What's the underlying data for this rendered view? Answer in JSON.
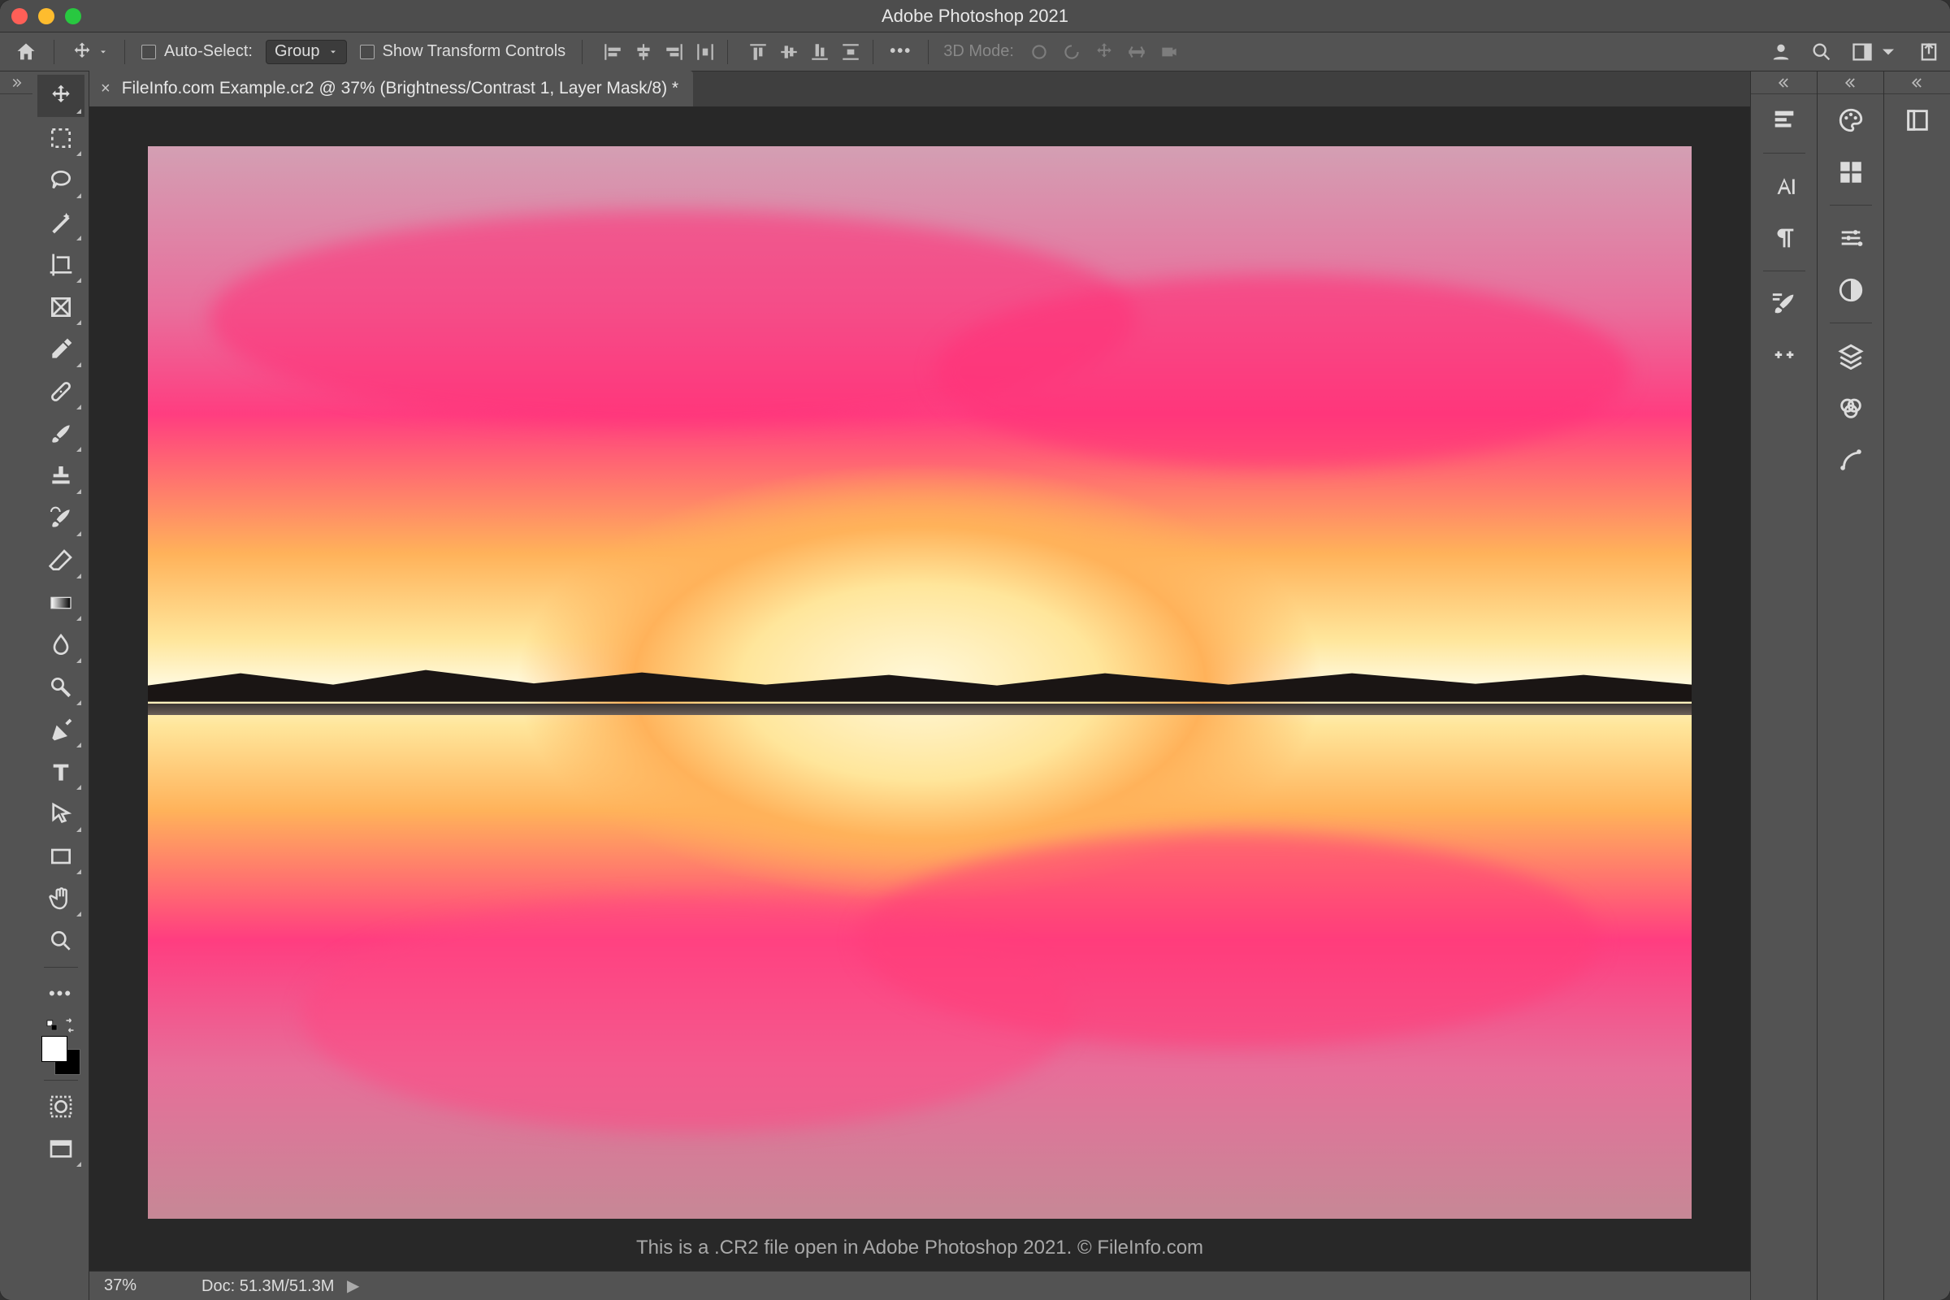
{
  "titlebar": {
    "title": "Adobe Photoshop 2021"
  },
  "optbar": {
    "auto_select_label": "Auto-Select:",
    "group_label": "Group",
    "show_transform_label": "Show Transform Controls",
    "mode3d_label": "3D Mode:"
  },
  "document": {
    "tab_label": "FileInfo.com Example.cr2 @ 37% (Brightness/Contrast 1, Layer Mask/8) *",
    "caption": "This is a .CR2 file open in Adobe Photoshop 2021. © FileInfo.com"
  },
  "status": {
    "zoom": "37%",
    "doc_info": "Doc: 51.3M/51.3M"
  },
  "tools": [
    {
      "name": "move-tool",
      "selected": true
    },
    {
      "name": "marquee-tool"
    },
    {
      "name": "lasso-tool"
    },
    {
      "name": "magic-wand-tool"
    },
    {
      "name": "crop-tool"
    },
    {
      "name": "frame-tool"
    },
    {
      "name": "eyedropper-tool"
    },
    {
      "name": "healing-brush-tool"
    },
    {
      "name": "brush-tool"
    },
    {
      "name": "clone-stamp-tool"
    },
    {
      "name": "history-brush-tool"
    },
    {
      "name": "eraser-tool"
    },
    {
      "name": "gradient-tool"
    },
    {
      "name": "pen-drop-tool"
    },
    {
      "name": "dodge-tool"
    },
    {
      "name": "pen-tool"
    },
    {
      "name": "type-tool"
    },
    {
      "name": "path-selection-tool"
    },
    {
      "name": "rectangle-tool"
    },
    {
      "name": "hand-tool"
    },
    {
      "name": "zoom-tool"
    }
  ],
  "right_panels": {
    "col1": [
      "properties-icon",
      "character-panel-icon",
      "paragraph-panel-icon",
      "brush-settings-icon",
      "clone-source-icon"
    ],
    "col2": [
      "color-panel-icon",
      "swatches-panel-icon",
      "adjustments-panel-icon",
      "styles-panel-icon",
      "layers-panel-icon",
      "channels-panel-icon",
      "paths-panel-icon"
    ],
    "col3": [
      "libraries-panel-icon"
    ]
  }
}
